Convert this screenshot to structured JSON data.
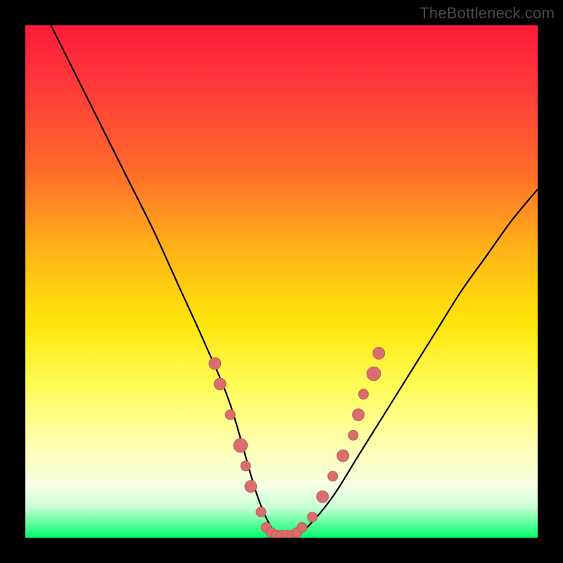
{
  "attribution": "TheBottleneck.com",
  "colors": {
    "frame": "#000000",
    "gradient_top": "#ff1a3a",
    "gradient_bottom": "#00ff6a",
    "curve": "#000000",
    "dot_fill": "#d96e6e",
    "dot_stroke": "#c85858"
  },
  "chart_data": {
    "type": "line",
    "title": "",
    "xlabel": "",
    "ylabel": "",
    "xlim": [
      0,
      100
    ],
    "ylim": [
      0,
      100
    ],
    "grid": false,
    "axes_visible": false,
    "legend": false,
    "series": [
      {
        "name": "bottleneck-curve",
        "x": [
          5,
          10,
          15,
          20,
          25,
          30,
          35,
          40,
          45,
          48,
          50,
          52,
          55,
          60,
          65,
          70,
          75,
          80,
          85,
          90,
          95,
          100
        ],
        "y": [
          100,
          90,
          80,
          70,
          60,
          49,
          38,
          26,
          9,
          2,
          0,
          0,
          2,
          8,
          16,
          24,
          32,
          40,
          48,
          55,
          62,
          68
        ]
      }
    ],
    "points": [
      {
        "name": "left-cluster",
        "x": 37,
        "y": 34,
        "r": 1.2
      },
      {
        "name": "left-cluster",
        "x": 38,
        "y": 30,
        "r": 1.2
      },
      {
        "name": "left-cluster",
        "x": 40,
        "y": 24,
        "r": 1.0
      },
      {
        "name": "left-cluster",
        "x": 42,
        "y": 18,
        "r": 1.4
      },
      {
        "name": "left-cluster",
        "x": 43,
        "y": 14,
        "r": 1.0
      },
      {
        "name": "left-cluster",
        "x": 44,
        "y": 10,
        "r": 1.2
      },
      {
        "name": "left-cluster",
        "x": 46,
        "y": 5,
        "r": 1.0
      },
      {
        "name": "bottom-bar",
        "x": 47,
        "y": 2,
        "r": 1.0
      },
      {
        "name": "bottom-bar",
        "x": 48,
        "y": 1,
        "r": 1.0
      },
      {
        "name": "bottom-bar",
        "x": 49,
        "y": 0.5,
        "r": 1.0
      },
      {
        "name": "bottom-bar",
        "x": 50,
        "y": 0.5,
        "r": 1.0
      },
      {
        "name": "bottom-bar",
        "x": 51,
        "y": 0.5,
        "r": 1.0
      },
      {
        "name": "bottom-bar",
        "x": 52,
        "y": 0.5,
        "r": 1.0
      },
      {
        "name": "bottom-bar",
        "x": 53,
        "y": 1,
        "r": 1.0
      },
      {
        "name": "bottom-bar",
        "x": 54,
        "y": 2,
        "r": 1.0
      },
      {
        "name": "right-cluster",
        "x": 56,
        "y": 4,
        "r": 1.0
      },
      {
        "name": "right-cluster",
        "x": 58,
        "y": 8,
        "r": 1.2
      },
      {
        "name": "right-cluster",
        "x": 60,
        "y": 12,
        "r": 1.0
      },
      {
        "name": "right-cluster",
        "x": 62,
        "y": 16,
        "r": 1.2
      },
      {
        "name": "right-cluster",
        "x": 64,
        "y": 20,
        "r": 1.0
      },
      {
        "name": "right-cluster",
        "x": 65,
        "y": 24,
        "r": 1.2
      },
      {
        "name": "right-cluster",
        "x": 66,
        "y": 28,
        "r": 1.0
      },
      {
        "name": "right-cluster",
        "x": 68,
        "y": 32,
        "r": 1.4
      },
      {
        "name": "right-cluster",
        "x": 69,
        "y": 36,
        "r": 1.2
      }
    ],
    "annotations": []
  }
}
